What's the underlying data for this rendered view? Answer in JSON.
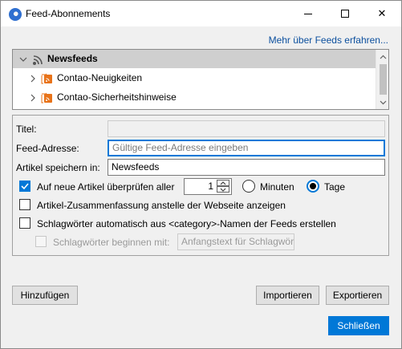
{
  "window": {
    "title": "Feed-Abonnements",
    "minimize_symbol": "",
    "maximize_symbol": "",
    "close_symbol": "✕"
  },
  "header": {
    "more_link": "Mehr über Feeds erfahren..."
  },
  "tree": {
    "root": {
      "label": "Newsfeeds",
      "icon": "rss-icon",
      "expanded": true
    },
    "items": [
      {
        "label": "Contao-Neuigkeiten",
        "icon": "feed-folder-icon",
        "expanded": false
      },
      {
        "label": "Contao-Sicherheitshinweise",
        "icon": "feed-folder-icon",
        "expanded": false
      }
    ]
  },
  "form": {
    "title_label": "Titel:",
    "title_value": "",
    "address_label": "Feed-Adresse:",
    "address_placeholder": "Gültige Feed-Adresse eingeben",
    "store_label": "Artikel speichern in:",
    "store_value": "Newsfeeds",
    "check_label": "Auf neue Artikel überprüfen aller",
    "check_checked": true,
    "interval_value": "1",
    "unit_minutes": "Minuten",
    "unit_days": "Tage",
    "selected_unit": "Tage",
    "summary_label": "Artikel-Zusammenfassung anstelle der Webseite anzeigen",
    "summary_checked": false,
    "tags_label": "Schlagwörter automatisch aus <category>-Namen der Feeds erstellen",
    "tags_checked": false,
    "prefix_label": "Schlagwörter beginnen mit:",
    "prefix_placeholder": "Anfangstext für Schlagwör",
    "prefix_enabled": false
  },
  "buttons": {
    "add": "Hinzufügen",
    "import": "Importieren",
    "export": "Exportieren",
    "close": "Schließen"
  },
  "colors": {
    "accent": "#0078d7",
    "link": "#0b4f9e",
    "rss_orange": "#e8731a",
    "selection": "#cfcfcf"
  }
}
